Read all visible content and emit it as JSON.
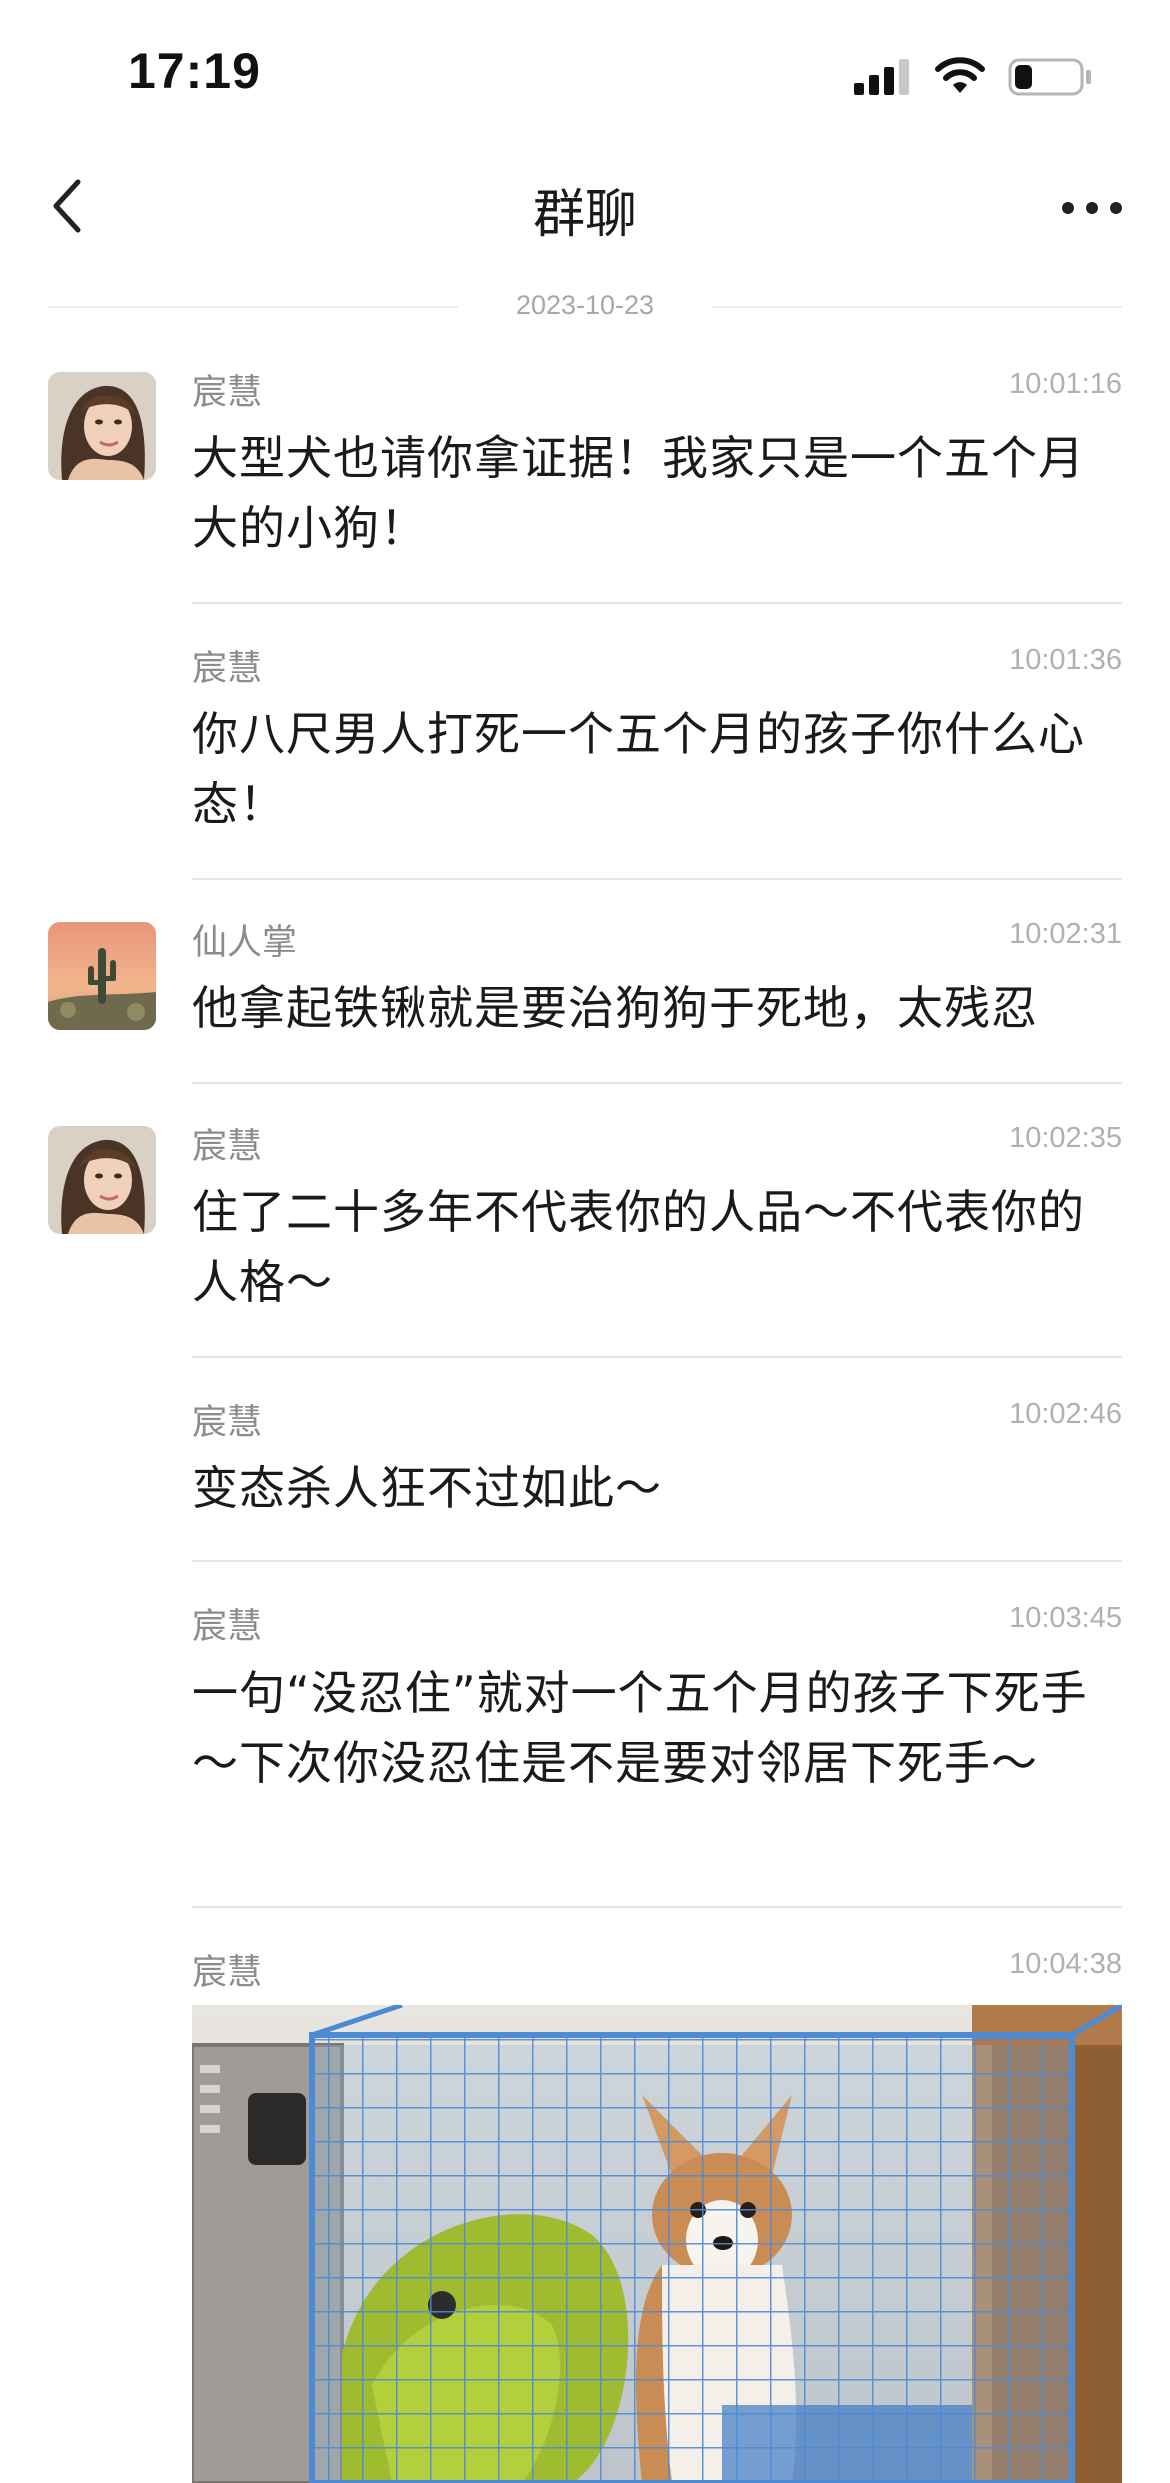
{
  "status_bar": {
    "time": "17:19",
    "battery_level": 0.28
  },
  "header": {
    "title": "群聊"
  },
  "date_divider": "2023-10-23",
  "messages": [
    {
      "sender": "宸慧",
      "time": "10:01:16",
      "text": "大型犬也请你拿证据！我家只是一个五个月大的小狗！",
      "avatar": "woman-portrait"
    },
    {
      "sender": "宸慧",
      "time": "10:01:36",
      "text": "你八尺男人打死一个五个月的孩子你什么心态！"
    },
    {
      "sender": "仙人掌",
      "time": "10:02:31",
      "text": "他拿起铁锹就是要治狗狗于死地，太残忍",
      "avatar": "desert-cactus"
    },
    {
      "sender": "宸慧",
      "time": "10:02:35",
      "text": "住了二十多年不代表你的人品～不代表你的人格～",
      "avatar": "woman-portrait"
    },
    {
      "sender": "宸慧",
      "time": "10:02:46",
      "text": "变态杀人狂不过如此～"
    },
    {
      "sender": "宸慧",
      "time": "10:03:45",
      "text": "一句“没忍住”就对一个五个月的孩子下死手～下次你没忍住是不是要对邻居下死手～"
    },
    {
      "sender": "宸慧",
      "time": "10:04:38",
      "image": "corgi-puppy-in-cage-photo"
    }
  ],
  "colors": {
    "text": "#1a1a1a",
    "meta": "#8c8c8c",
    "time": "#b0b0b0",
    "divider": "#e6e6e6"
  }
}
